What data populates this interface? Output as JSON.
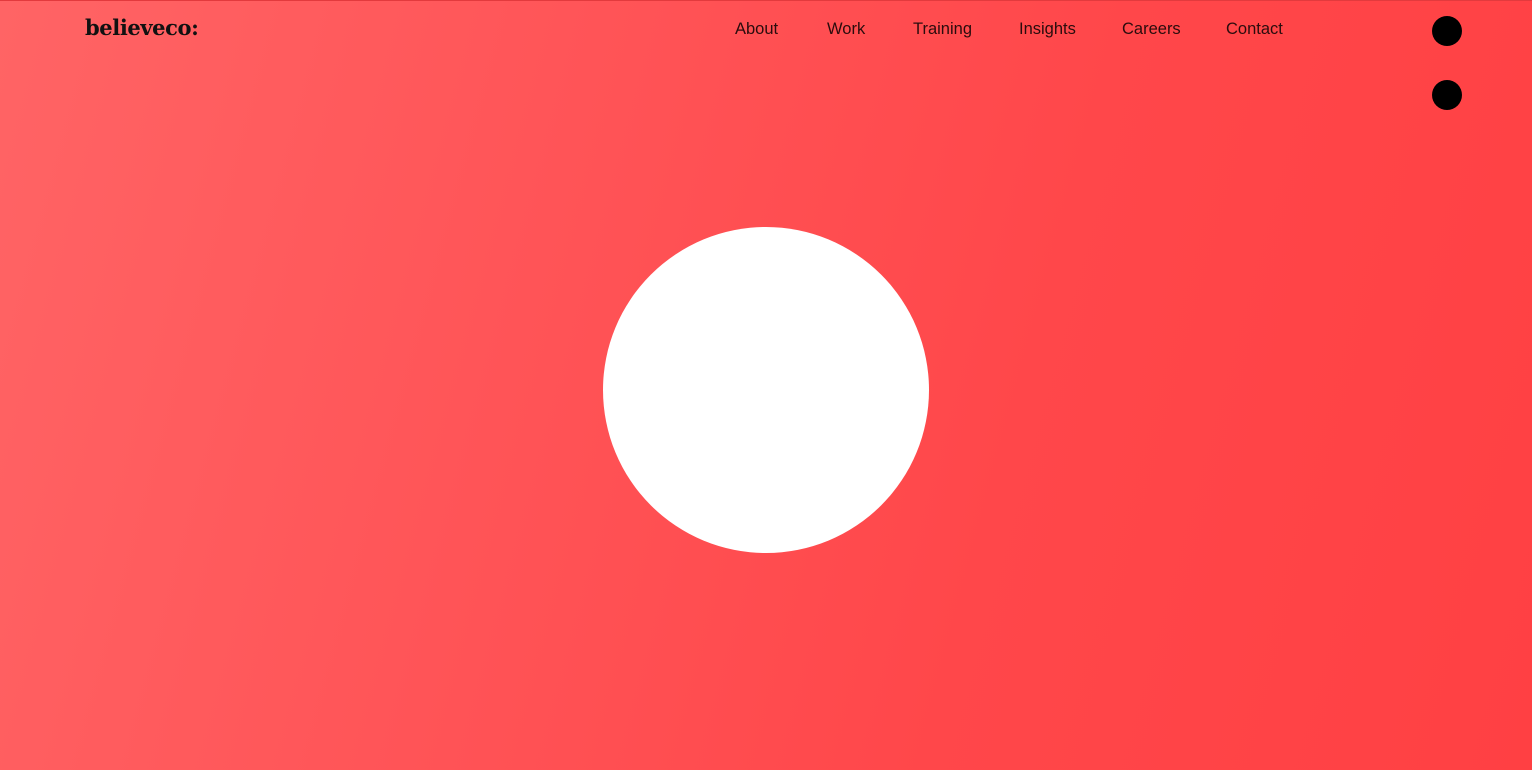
{
  "header": {
    "logo_text": "believeco:",
    "nav": [
      {
        "label": "About"
      },
      {
        "label": "Work"
      },
      {
        "label": "Training"
      },
      {
        "label": "Insights"
      },
      {
        "label": "Careers"
      },
      {
        "label": "Contact"
      }
    ]
  },
  "icons": {
    "menu_dot_top": "circle-dot-icon",
    "menu_dot_bottom": "circle-dot-icon"
  },
  "colors": {
    "background_start": "#ff6465",
    "background_end": "#ff4043",
    "text": "#2a0c0d",
    "hero_circle": "#ffffff",
    "dots": "#000000"
  }
}
